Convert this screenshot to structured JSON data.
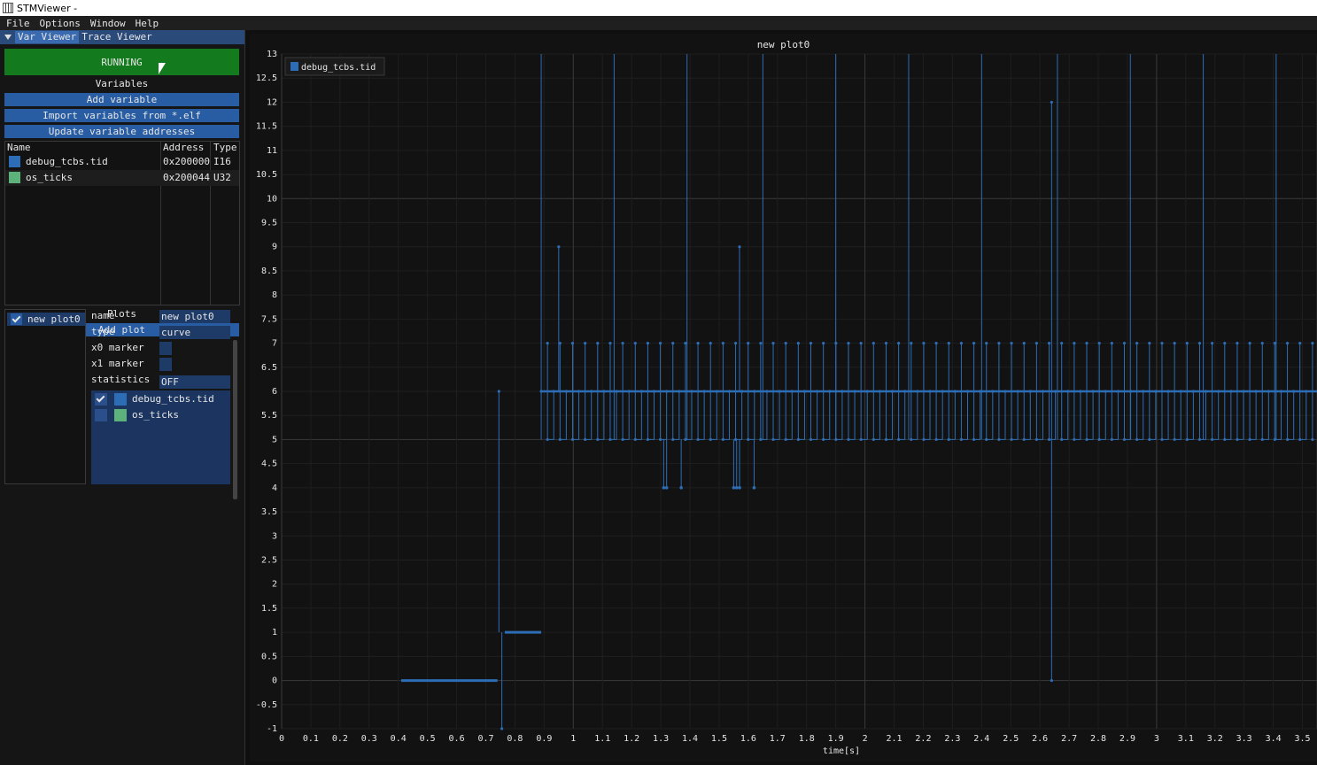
{
  "window": {
    "title": "STMViewer -"
  },
  "menu": [
    "File",
    "Options",
    "Window",
    "Help"
  ],
  "tabs": [
    {
      "label": "Var Viewer",
      "active": true
    },
    {
      "label": "Trace Viewer",
      "active": false
    }
  ],
  "run_button": {
    "label": "RUNNING",
    "color": "#137a1e"
  },
  "variables": {
    "title": "Variables",
    "buttons": {
      "add": "Add variable",
      "import": "Import variables from *.elf",
      "update": "Update variable addresses"
    },
    "columns": [
      "Name",
      "Address",
      "Type"
    ],
    "rows": [
      {
        "name": "debug_tcbs.tid",
        "address": "0x200000",
        "type": "I16",
        "color": "#2d6db5"
      },
      {
        "name": "os_ticks",
        "address": "0x200044",
        "type": "U32",
        "color": "#5cb27a"
      }
    ]
  },
  "plots": {
    "title": "Plots",
    "add_button": "Add plot",
    "items": [
      {
        "name": "new plot0",
        "checked": true
      }
    ],
    "props": {
      "name_label": "name",
      "name_value": "new plot0",
      "type_label": "type",
      "type_value": "curve",
      "x0_label": "x0 marker",
      "x1_label": "x1 marker",
      "stats_label": "statistics",
      "stats_value": "OFF"
    },
    "series": [
      {
        "name": "debug_tcbs.tid",
        "checked": true,
        "color": "#2d6db5"
      },
      {
        "name": "os_ticks",
        "checked": false,
        "color": "#5cb27a"
      }
    ]
  },
  "chart_data": {
    "type": "line",
    "title": "new plot0",
    "xlabel": "time[s]",
    "ylabel": "",
    "xlim": [
      0,
      3.55
    ],
    "ylim": [
      -1,
      13
    ],
    "x_ticks": [
      0,
      0.1,
      0.2,
      0.3,
      0.4,
      0.5,
      0.6,
      0.7,
      0.8,
      0.9,
      1,
      1.1,
      1.2,
      1.3,
      1.4,
      1.5,
      1.6,
      1.7,
      1.8,
      1.9,
      2,
      2.1,
      2.2,
      2.3,
      2.4,
      2.5,
      2.6,
      2.7,
      2.8,
      2.9,
      3,
      3.1,
      3.2,
      3.3,
      3.4,
      3.5
    ],
    "y_ticks": [
      -1,
      -0.5,
      0,
      0.5,
      1,
      1.5,
      2,
      2.5,
      3,
      3.5,
      4,
      4.5,
      5,
      5.5,
      6,
      6.5,
      7,
      7.5,
      8,
      8.5,
      9,
      9.5,
      10,
      10.5,
      11,
      11.5,
      12,
      12.5,
      13
    ],
    "grid": true,
    "legend": "top-left",
    "series": [
      {
        "name": "debug_tcbs.tid",
        "color": "#2d6db5",
        "segments": [
          {
            "x0": 0.41,
            "x1": 0.74,
            "y": 0
          },
          {
            "x0": 0.765,
            "x1": 0.89,
            "y": 1
          }
        ],
        "spikes_to_13": [
          0.89,
          1.14,
          1.39,
          1.65,
          1.9,
          2.15,
          2.4,
          2.66,
          2.91,
          3.16,
          3.41
        ],
        "spikes_other": [
          {
            "x": 0.745,
            "y": 6
          },
          {
            "x": 0.755,
            "y": -1
          },
          {
            "x": 0.95,
            "y": 9
          },
          {
            "x": 1.57,
            "y": 9
          },
          {
            "x": 2.64,
            "y": 12
          },
          {
            "x": 2.64,
            "y": 0
          }
        ],
        "dips_to_4": [
          1.31,
          1.32,
          1.37,
          1.55,
          1.56,
          1.57,
          1.62
        ],
        "baseline_high": 6,
        "baseline_low": 5,
        "pulse_peak": 7
      }
    ]
  }
}
